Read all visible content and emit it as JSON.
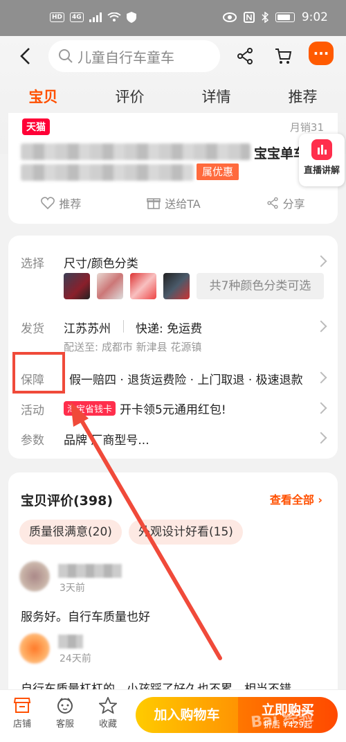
{
  "status_bar": {
    "time": "9:02",
    "badges": [
      "HD",
      "4G"
    ],
    "icons": [
      "signal-icon",
      "wifi-icon",
      "shield-icon",
      "eye-icon",
      "nfc-icon",
      "bluetooth-icon",
      "battery-icon"
    ]
  },
  "header": {
    "search_placeholder": "儿童自行车童车",
    "more_label": "..."
  },
  "tabs": [
    "宝贝",
    "评价",
    "详情",
    "推荐"
  ],
  "active_tab": "宝贝",
  "product": {
    "store_badge": "天猫",
    "sales": "月销31",
    "title_visible": "宝宝单车",
    "coupon": "属优惠",
    "live_label": "直播讲解",
    "actions": [
      "推荐",
      "送给TA",
      "分享"
    ]
  },
  "options": {
    "select": {
      "label": "选择",
      "value": "尺寸/颜色分类",
      "more": "共7种颜色分类可选"
    },
    "ship": {
      "label": "发货",
      "origin": "江苏苏州",
      "fee": "快递: 免运费",
      "dest": "配送至: 成都市 新津县 花源镇"
    },
    "guarantee": {
      "label": "保障",
      "value": "假一赔四 · 退货运费险 · 上门取退 · 极速退款"
    },
    "activity": {
      "label": "活动",
      "badge": "淘宝省钱卡",
      "value": "开卡领5元通用红包!"
    },
    "params": {
      "label": "参数",
      "value": "品牌 厂商型号..."
    }
  },
  "reviews": {
    "title": "宝贝评价(398)",
    "view_all": "查看全部 ›",
    "tags": [
      "质量很满意(20)",
      "外观设计好看(15)"
    ],
    "items": [
      {
        "time": "3天前",
        "text": "服务好。自行车质量也好"
      },
      {
        "time": "24天前",
        "text": "自行车质量杠杠的，小孩踩了好久也不累，相当不错"
      }
    ]
  },
  "bottom_bar": {
    "items": [
      "店铺",
      "客服",
      "收藏"
    ],
    "add_cart": "加入购物车",
    "buy_now": "立即购买",
    "buy_sub": "折后 ¥429起"
  },
  "watermark": "Bai 经验",
  "colors": {
    "accent": "#ff5000",
    "annotation": "#f04a3a"
  }
}
